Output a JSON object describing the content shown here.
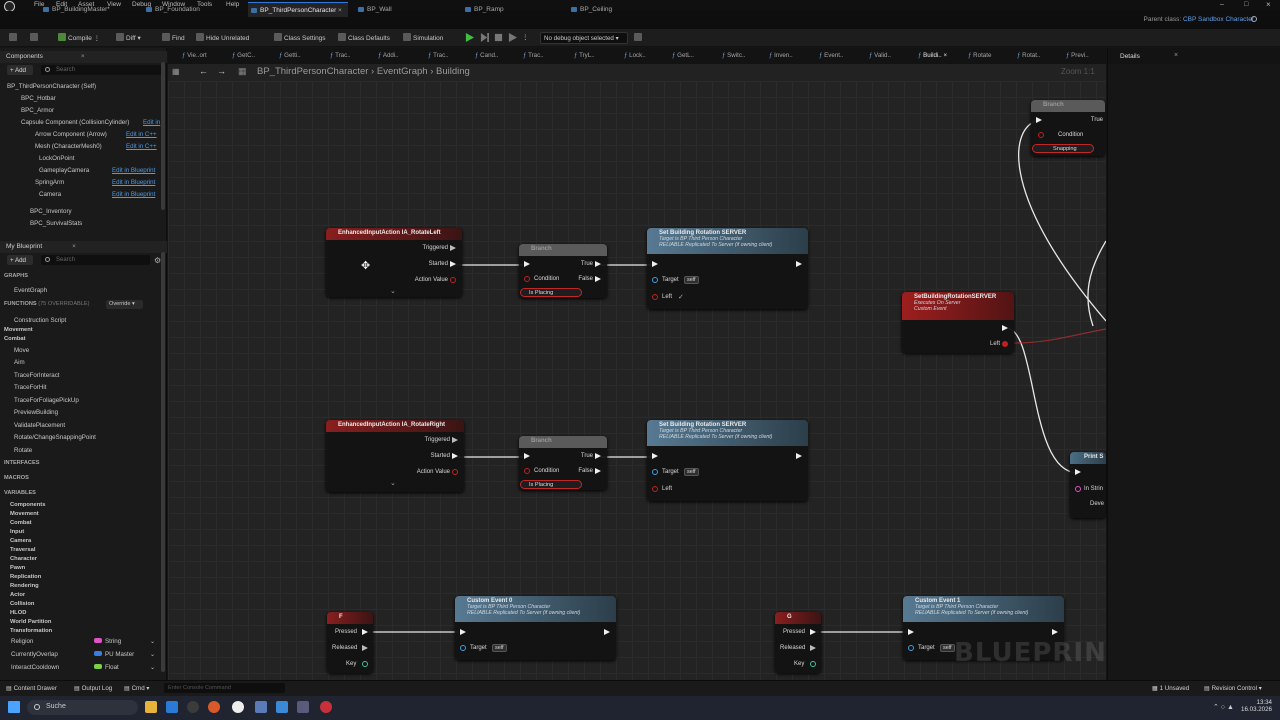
{
  "menu": [
    "File",
    "Edit",
    "Asset",
    "View",
    "Debug",
    "Window",
    "Tools",
    "Help"
  ],
  "tabs": [
    {
      "label": "BP_BuildingMaster*",
      "active": false
    },
    {
      "label": "BP_Foundation",
      "active": false
    },
    {
      "label": "BP_ThirdPersonCharacter",
      "active": true
    },
    {
      "label": "BP_Wall",
      "active": false
    },
    {
      "label": "BP_Ramp",
      "active": false
    },
    {
      "label": "BP_Ceiling",
      "active": false
    }
  ],
  "parent_class": {
    "prefix": "Parent class:",
    "value": "CBP Sandbox Character"
  },
  "toolbar": {
    "compile": "Compile",
    "diff": "Diff",
    "find": "Find",
    "hide_unrelated": "Hide Unrelated",
    "class_settings": "Class Settings",
    "class_defaults": "Class Defaults",
    "simulation": "Simulation",
    "debug_object": "No debug object selected"
  },
  "components_panel": {
    "title": "Components",
    "add": "+ Add",
    "search_placeholder": "Search",
    "items": [
      {
        "label": "BP_ThirdPersonCharacter (Self)",
        "edit": ""
      },
      {
        "label": "BPC_Hotbar",
        "edit": ""
      },
      {
        "label": "BPC_Armor",
        "edit": ""
      },
      {
        "label": "Capsule Component (CollisionCylinder)",
        "edit": "Edit in"
      },
      {
        "label": "Arrow Component (Arrow)",
        "edit": "Edit in C++"
      },
      {
        "label": "Mesh (CharacterMesh0)",
        "edit": "Edit in C++"
      },
      {
        "label": "LockOnPoint",
        "edit": ""
      },
      {
        "label": "GameplayCamera",
        "edit": "Edit in Blueprint"
      },
      {
        "label": "SpringArm",
        "edit": "Edit in Blueprint"
      },
      {
        "label": "Camera",
        "edit": "Edit in Blueprint"
      },
      {
        "label": "BPC_Inventory",
        "edit": ""
      },
      {
        "label": "BPC_SurvivalStats",
        "edit": ""
      }
    ]
  },
  "my_blueprint": {
    "title": "My Blueprint",
    "add": "+ Add",
    "search_placeholder": "Search",
    "graphs_label": "GRAPHS",
    "event_graph": "EventGraph",
    "functions_label": "FUNCTIONS",
    "functions_overridable": "(75 OVERRIDABLE)",
    "override": "Override",
    "functions": [
      "Construction Script",
      "Movement",
      "Combat",
      "Move",
      "Aim",
      "TraceForInteract",
      "TraceForHit",
      "TraceForFoliagePickUp",
      "PreviewBuilding",
      "ValidatePlacement",
      "Rotate/ChangeSnappingPoint",
      "Rotate"
    ],
    "interfaces_label": "INTERFACES",
    "macros_label": "MACROS",
    "variables_label": "VARIABLES",
    "variable_categories": [
      "Components",
      "Movement",
      "Combat",
      "Input",
      "Camera",
      "Traversal",
      "Character",
      "Pawn",
      "Replication",
      "Rendering",
      "Actor",
      "Collision",
      "HLOD",
      "World Partition",
      "Transformation"
    ],
    "variables": [
      {
        "name": "Religion",
        "type": "String",
        "color": "#e052c8"
      },
      {
        "name": "CurrentlyOverlap",
        "type": "PU Master",
        "color": "#3d7be0"
      },
      {
        "name": "InteractCooldown",
        "type": "Float",
        "color": "#7ad04a"
      }
    ]
  },
  "graph_tabs": [
    "Vie..ort",
    "GetC..",
    "Getti..",
    "Trac..",
    "Addi..",
    "Trac..",
    "Cand..",
    "Trac..",
    "TryL..",
    "Lock..",
    "GetL..",
    "Switc..",
    "Inven..",
    "Event..",
    "Valid..",
    "Buildi..",
    "Rotate",
    "Rotat..",
    "Previ.."
  ],
  "breadcrumb": {
    "bp": "BP_ThirdPersonCharacter",
    "graph": "EventGraph",
    "sub": "Building",
    "zoom": "Zoom 1:1"
  },
  "details_title": "Details",
  "nodes": {
    "rotate_left": {
      "title": "EnhancedInputAction IA_RotateLeft",
      "triggered": "Triggered",
      "started": "Started",
      "action_value": "Action Value"
    },
    "branch1": {
      "title": "Branch",
      "true": "True",
      "false": "False",
      "condition": "Condition",
      "is_placing": "Is Placing"
    },
    "set_rot1": {
      "title": "Set Building Rotation SERVER",
      "sub1": "Target is BP Third Person Character",
      "sub2": "RELIABLE Replicated To Server (if owning client)",
      "target": "Target",
      "self": "self",
      "left": "Left"
    },
    "server_event": {
      "title": "SetBuildingRotationSERVER",
      "sub1": "Executes On Server",
      "sub2": "Custom Event",
      "left": "Left"
    },
    "rotate_right": {
      "title": "EnhancedInputAction IA_RotateRight",
      "triggered": "Triggered",
      "started": "Started",
      "action_value": "Action Value"
    },
    "branch2": {
      "title": "Branch",
      "true": "True",
      "false": "False",
      "condition": "Condition",
      "is_placing": "Is Placing"
    },
    "set_rot2": {
      "title": "Set Building Rotation SERVER",
      "sub1": "Target is BP Third Person Character",
      "sub2": "RELIABLE Replicated To Server (if owning client)",
      "target": "Target",
      "self": "self",
      "left": "Left"
    },
    "branch_top": {
      "title": "Branch",
      "true": "True",
      "condition": "Condition",
      "snapping": "Snapping"
    },
    "key_f": {
      "title": "F",
      "pressed": "Pressed",
      "released": "Released",
      "key": "Key"
    },
    "custom0": {
      "title": "Custom Event 0",
      "sub1": "Target is BP Third Person Character",
      "sub2": "RELIABLE Replicated To Server (if owning client)",
      "target": "Target",
      "self": "self"
    },
    "key_g": {
      "title": "G",
      "pressed": "Pressed",
      "released": "Released",
      "key": "Key"
    },
    "custom1": {
      "title": "Custom Event 1",
      "sub1": "Target is BP Third Person Character",
      "sub2": "RELIABLE Replicated To Server (if owning client)",
      "target": "Target",
      "self": "self"
    },
    "print_node": {
      "title": "Print S",
      "in_string": "In Strin",
      "dev": "Deve"
    }
  },
  "watermark": "BLUEPRINT",
  "statusbar": {
    "content_drawer": "Content Drawer",
    "output_log": "Output Log",
    "cmd": "Cmd",
    "console_placeholder": "Enter Console Command",
    "unsaved": "1 Unsaved",
    "revision": "Revision Control"
  },
  "taskbar": {
    "search": "Suche",
    "time": "13:34",
    "date": "16.03.2026"
  }
}
